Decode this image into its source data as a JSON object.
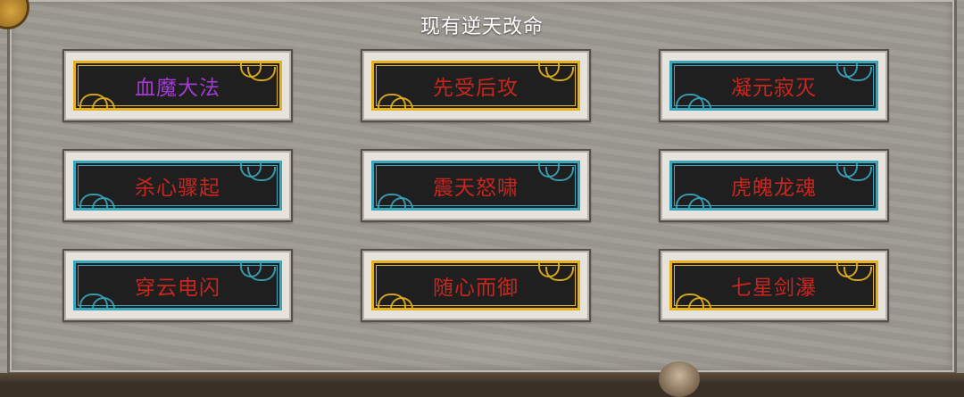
{
  "title": "现有逆天改命",
  "colors": {
    "gold": "#e6b21c",
    "cyan": "#3aa6bd",
    "purple_text": "#a13bd1",
    "red_text": "#c8261f"
  },
  "buttons": [
    {
      "label": "血魔大法",
      "frame": "gold",
      "text_color": "#a13bd1"
    },
    {
      "label": "先受后攻",
      "frame": "gold",
      "text_color": "#c8261f"
    },
    {
      "label": "凝元寂灭",
      "frame": "cyan",
      "text_color": "#c8261f"
    },
    {
      "label": "杀心骤起",
      "frame": "cyan",
      "text_color": "#c8261f"
    },
    {
      "label": "震天怒啸",
      "frame": "cyan",
      "text_color": "#c8261f"
    },
    {
      "label": "虎魄龙魂",
      "frame": "cyan",
      "text_color": "#c8261f"
    },
    {
      "label": "穿云电闪",
      "frame": "cyan",
      "text_color": "#c8261f"
    },
    {
      "label": "随心而御",
      "frame": "gold",
      "text_color": "#c8261f"
    },
    {
      "label": "七星剑瀑",
      "frame": "gold",
      "text_color": "#c8261f"
    }
  ]
}
